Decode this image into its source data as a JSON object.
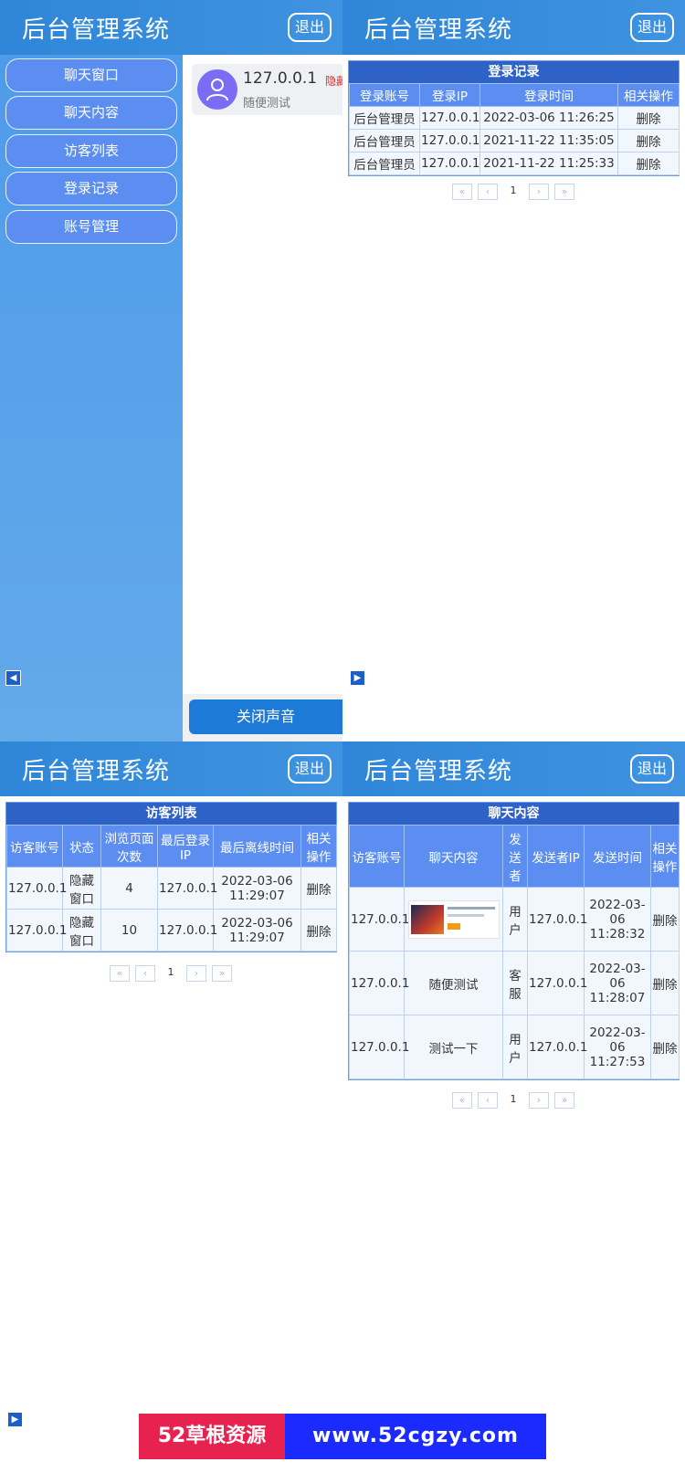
{
  "app": {
    "title": "后台管理系统",
    "logout_label": "退出"
  },
  "sidebar": {
    "items": [
      {
        "label": "聊天窗口"
      },
      {
        "label": "聊天内容"
      },
      {
        "label": "访客列表"
      },
      {
        "label": "登录记录"
      },
      {
        "label": "账号管理"
      }
    ],
    "toggle_glyph": "◀"
  },
  "chat": {
    "session": {
      "ip": "127.0.0.1",
      "tag": "隐藏窗",
      "last_message": "随便测试"
    },
    "sound_button": "关闭声音"
  },
  "login_records": {
    "title": "登录记录",
    "headers": [
      "登录账号",
      "登录IP",
      "登录时间",
      "相关操作"
    ],
    "rows": [
      [
        "后台管理员",
        "127.0.0.1",
        "2022-03-06 11:26:25",
        "删除"
      ],
      [
        "后台管理员",
        "127.0.0.1",
        "2021-11-22 11:35:05",
        "删除"
      ],
      [
        "后台管理员",
        "127.0.0.1",
        "2021-11-22 11:25:33",
        "删除"
      ]
    ],
    "toggle_glyph": "▶"
  },
  "visitors": {
    "title": "访客列表",
    "headers": [
      "访客账号",
      "状态",
      "浏览页面次数",
      "最后登录IP",
      "最后离线时间",
      "相关操作"
    ],
    "rows": [
      [
        "127.0.0.1",
        "隐藏窗口",
        "4",
        "127.0.0.1",
        "2022-03-06 11:29:07",
        "删除"
      ],
      [
        "127.0.0.1",
        "隐藏窗口",
        "10",
        "127.0.0.1",
        "2022-03-06 11:29:07",
        "删除"
      ]
    ]
  },
  "chat_content": {
    "title": "聊天内容",
    "headers": [
      "访客账号",
      "聊天内容",
      "发送者",
      "发送者IP",
      "发送时间",
      "相关操作"
    ],
    "rows": [
      [
        "127.0.0.1",
        "",
        "用户",
        "127.0.0.1",
        "2022-03-06 11:28:32",
        "删除"
      ],
      [
        "127.0.0.1",
        "随便测试",
        "客服",
        "127.0.0.1",
        "2022-03-06 11:28:07",
        "删除"
      ],
      [
        "127.0.0.1",
        "测试一下",
        "用户",
        "127.0.0.1",
        "2022-03-06 11:27:53",
        "删除"
      ]
    ],
    "toggle_glyph": "▶"
  },
  "pagination": {
    "first": "«",
    "prev": "‹",
    "current": "1",
    "next": "›",
    "last": "»"
  },
  "banner": {
    "left": "52草根资源",
    "right": "www.52cgzy.com"
  }
}
